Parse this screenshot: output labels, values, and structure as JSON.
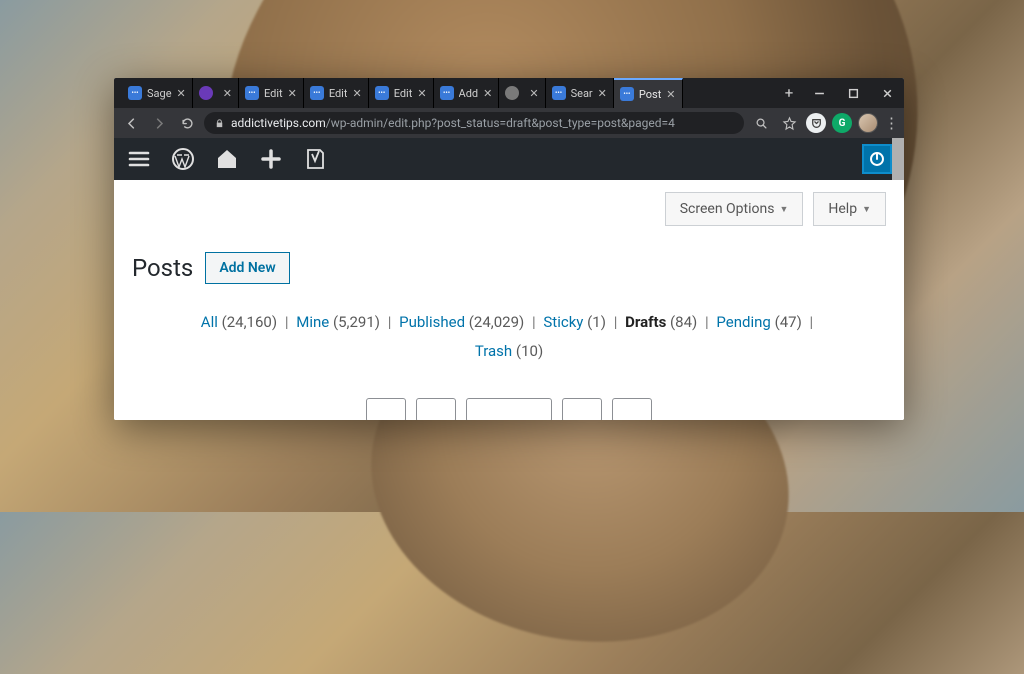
{
  "browser": {
    "tabs": [
      {
        "label": "Sage",
        "favicon": "blue"
      },
      {
        "label": "",
        "favicon": "purple"
      },
      {
        "label": "Edit",
        "favicon": "blue"
      },
      {
        "label": "Edit",
        "favicon": "blue"
      },
      {
        "label": "Edit",
        "favicon": "blue"
      },
      {
        "label": "Add",
        "favicon": "blue"
      },
      {
        "label": "",
        "favicon": "grey"
      },
      {
        "label": "Sear",
        "favicon": "blue"
      },
      {
        "label": "Post",
        "favicon": "blue",
        "active": true
      }
    ],
    "url_host": "addictivetips.com",
    "url_path": "/wp-admin/edit.php?post_status=draft&post_type=post&paged=4"
  },
  "panel": {
    "screen_options": "Screen Options",
    "help": "Help"
  },
  "page": {
    "title": "Posts",
    "add_new": "Add New"
  },
  "filters": {
    "all": {
      "label": "All",
      "count": "24,160"
    },
    "mine": {
      "label": "Mine",
      "count": "5,291"
    },
    "published": {
      "label": "Published",
      "count": "24,029"
    },
    "sticky": {
      "label": "Sticky",
      "count": "1"
    },
    "drafts": {
      "label": "Drafts",
      "count": "84"
    },
    "pending": {
      "label": "Pending",
      "count": "47"
    },
    "trash": {
      "label": "Trash",
      "count": "10"
    }
  }
}
